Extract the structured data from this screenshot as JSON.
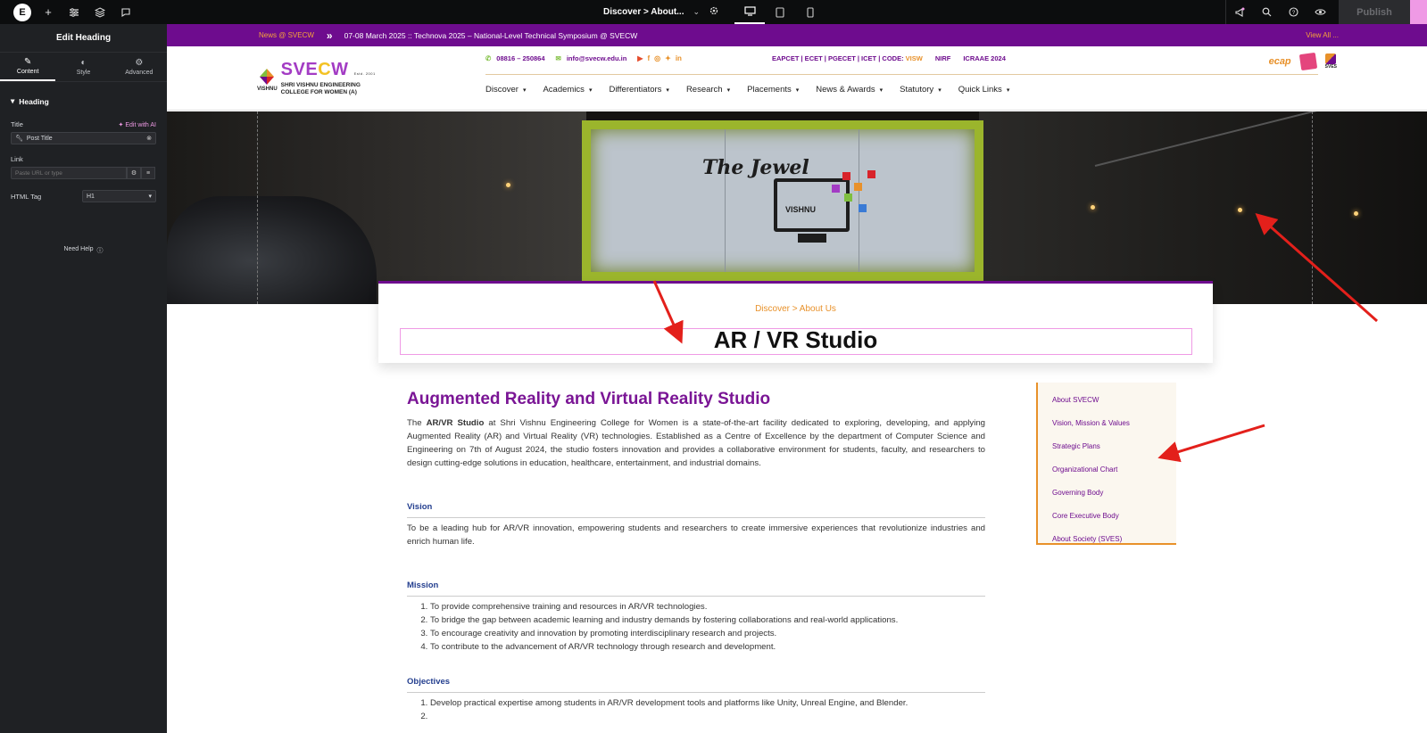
{
  "editor": {
    "topbar": {
      "logo": "E",
      "page_selector": "Discover > About...",
      "publish": "Publish"
    },
    "panel": {
      "title": "Edit Heading",
      "tabs": [
        "Content",
        "Style",
        "Advanced"
      ],
      "section": "Heading",
      "title_label": "Title",
      "edit_ai": "Edit with AI",
      "title_value": "Post Title",
      "link_label": "Link",
      "link_placeholder": "Paste URL or type",
      "html_tag_label": "HTML Tag",
      "html_tag_value": "H1",
      "need_help": "Need Help"
    },
    "accent": "#ef9ae5"
  },
  "site": {
    "newsbar": {
      "label": "News @ SVECW",
      "headline": "07-08 March 2025 :: Technova 2025 – National-Level Technical Symposium @ SVECW",
      "view_all": "View All ..."
    },
    "logo": {
      "wordmark_a": "SVE",
      "wordmark_b": "C",
      "wordmark_c": "W",
      "since": "Estd. 2001",
      "brand": "VISHNU",
      "college_line1": "SHRI VISHNU ENGINEERING",
      "college_line2": "COLLEGE FOR WOMEN (A)"
    },
    "contact": {
      "phone": "08816 – 250864",
      "email": "info@svecw.edu.in"
    },
    "codes": {
      "eapcet": "EAPCET | ECET | PGECET | ICET | CODE:",
      "code": "VISW",
      "nirf": "NIRF",
      "icraae": "ICRAAE 2024"
    },
    "partners": {
      "ecap": "ecap",
      "sves": "SVES"
    },
    "nav": [
      "Discover",
      "Academics",
      "Differentiators",
      "Research",
      "Placements",
      "News & Awards",
      "Statutory",
      "Quick Links"
    ],
    "hero": {
      "sign": "The Jewel",
      "brand": "VISHNU"
    },
    "breadcrumb": "Discover > About Us",
    "page_title": "AR / VR Studio",
    "content": {
      "heading": "Augmented Reality and Virtual Reality Studio",
      "intro_pre": "The ",
      "intro_bold": "AR/VR Studio",
      "intro_post": " at Shri Vishnu Engineering College for Women is a state-of-the-art facility dedicated to exploring, developing, and applying Augmented Reality (AR) and Virtual Reality (VR) technologies. Established as a Centre of Excellence by the department of Computer Science and Engineering on 7th of August 2024, the studio fosters innovation and provides a collaborative environment for students, faculty, and researchers to design cutting-edge solutions in education, healthcare, entertainment, and industrial domains.",
      "vision_title": "Vision",
      "vision_text": "To be a leading hub for AR/VR innovation, empowering students and researchers to create immersive experiences that revolutionize industries and enrich human life.",
      "mission_title": "Mission",
      "mission": [
        "To provide comprehensive training and resources in AR/VR technologies.",
        "To bridge the gap between academic learning and industry demands by fostering collaborations and real-world applications.",
        "To encourage creativity and innovation by promoting interdisciplinary research and projects.",
        "To contribute to the advancement of AR/VR technology through research and development."
      ],
      "objectives_title": "Objectives",
      "objectives": [
        "Develop practical expertise among students in AR/VR development tools and platforms like Unity, Unreal Engine, and Blender.",
        ""
      ]
    },
    "sidebar": [
      "About SVECW",
      "Vision, Mission & Values",
      "Strategic Plans",
      "Organizational Chart",
      "Governing Body",
      "Core Executive Body",
      "About Society (SVES)"
    ],
    "colors": {
      "brand_purple": "#6e0c8e",
      "brand_orange": "#e8912a",
      "heading_purple": "#7a1595",
      "section_blue": "#243f8f",
      "annotation_red": "#e3201b"
    }
  }
}
